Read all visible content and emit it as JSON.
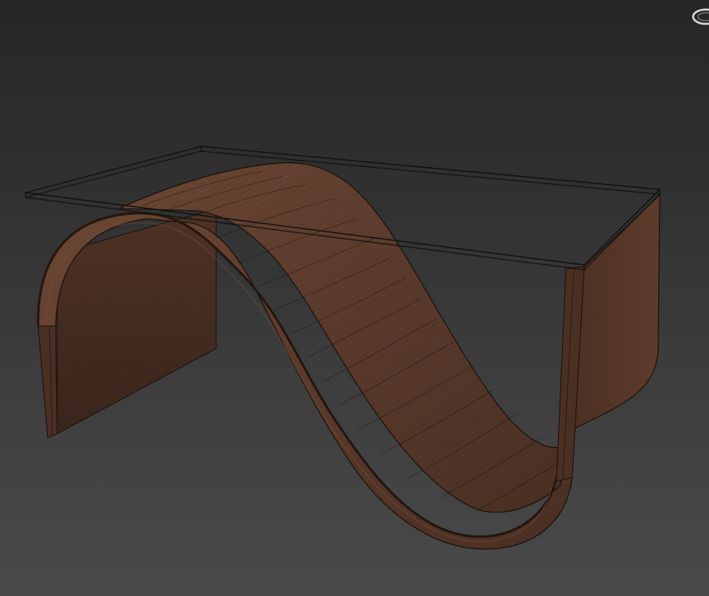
{
  "viewport": {
    "background_top": "#262626",
    "background_bottom": "#4a4a4a"
  },
  "model": {
    "wood_color": "#5a3a2c",
    "wood_dark": "#3e271d",
    "wood_light": "#6e4a38",
    "wire_color": "#000000",
    "glass_outline": "#101010"
  },
  "icons": {
    "viewcube": "viewcube-ring-icon"
  }
}
